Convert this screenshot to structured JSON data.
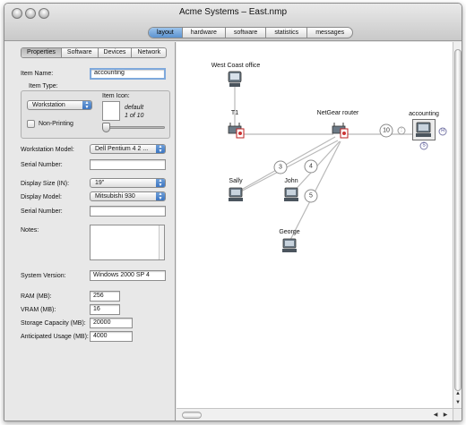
{
  "window": {
    "title": "Acme Systems – East.nmp"
  },
  "toolbar": {
    "tabs": [
      {
        "label": "layout"
      },
      {
        "label": "hardware"
      },
      {
        "label": "software"
      },
      {
        "label": "statistics"
      },
      {
        "label": "messages"
      }
    ],
    "selected": "layout"
  },
  "inspector": {
    "tabs": [
      {
        "label": "Properties"
      },
      {
        "label": "Software"
      },
      {
        "label": "Devices"
      },
      {
        "label": "Network"
      }
    ],
    "selected_tab": "Properties",
    "item_name": {
      "label": "Item Name:",
      "value": "accounting"
    },
    "item_type": {
      "label": "Item Type:",
      "value": "Workstation"
    },
    "item_icon": {
      "label": "Item Icon:",
      "status": "default",
      "count": "1 of 10"
    },
    "non_printing": {
      "label": "Non-Printing",
      "checked": false
    },
    "workstation_model": {
      "label": "Workstation Model:",
      "value": "Dell Pentium 4 2 ..."
    },
    "serial_number_1": {
      "label": "Serial Number:",
      "value": ""
    },
    "display_size": {
      "label": "Display Size (IN):",
      "value": "19\""
    },
    "display_model": {
      "label": "Display Model:",
      "value": "Mitsubishi 930"
    },
    "serial_number_2": {
      "label": "Serial Number:",
      "value": ""
    },
    "notes": {
      "label": "Notes:",
      "value": ""
    },
    "system_version": {
      "label": "System  Version:",
      "value": "Windows 2000 SP 4"
    },
    "ram": {
      "label": "RAM (MB):",
      "value": "256"
    },
    "vram": {
      "label": "VRAM (MB):",
      "value": "16"
    },
    "storage": {
      "label": "Storage Capacity (MB):",
      "value": "20000"
    },
    "usage": {
      "label": "Anticipated Usage (MB):",
      "value": "4000"
    }
  },
  "network_map": {
    "nodes": [
      {
        "id": "west",
        "label": "West Coast office",
        "kind": "server-icon"
      },
      {
        "id": "t1",
        "label": "T1",
        "kind": "router-icon"
      },
      {
        "id": "netgear",
        "label": "NetGear router",
        "kind": "router-icon"
      },
      {
        "id": "accounting",
        "label": "accounting",
        "kind": "workstation-icon"
      },
      {
        "id": "sally",
        "label": "Sally",
        "kind": "workstation-icon"
      },
      {
        "id": "john",
        "label": "John",
        "kind": "workstation-icon"
      },
      {
        "id": "george",
        "label": "George",
        "kind": "workstation-icon"
      }
    ],
    "link_badges": [
      {
        "id": "b3",
        "label": "3"
      },
      {
        "id": "b4",
        "label": "4"
      },
      {
        "id": "b5",
        "label": "5"
      },
      {
        "id": "b10",
        "label": "10"
      }
    ],
    "accounting_markers": [
      {
        "id": "h",
        "label": "H"
      },
      {
        "id": "s",
        "label": "S"
      }
    ]
  },
  "colors": {
    "selected_segment": "#5b93d0",
    "focus_ring": "#7fa9dc",
    "link_line": "#b9b9b9"
  }
}
